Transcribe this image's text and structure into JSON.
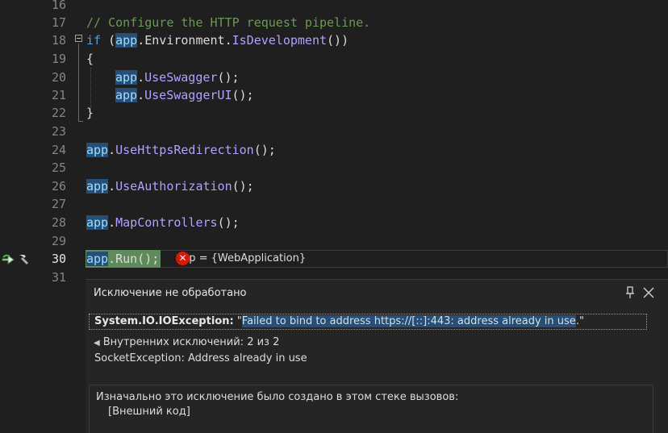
{
  "editor": {
    "line_numbers": [
      "16",
      "17",
      "18",
      "19",
      "20",
      "21",
      "22",
      "23",
      "24",
      "25",
      "26",
      "27",
      "28",
      "29",
      "30",
      "31"
    ],
    "current_line": "30",
    "lines": {
      "l17": "// Configure the HTTP request pipeline.",
      "l18_kw": "if",
      "l18_open": " (",
      "l18_var": "app",
      "l18_dot": ".",
      "l18_prop": "Environment",
      "l18_dot2": ".",
      "l18_method": "IsDevelopment",
      "l18_close": "())",
      "l19": "{",
      "l20_var": "app",
      "l20_dot": ".",
      "l20_method": "UseSwagger",
      "l20_end": "();",
      "l21_var": "app",
      "l21_dot": ".",
      "l21_method": "UseSwaggerUI",
      "l21_end": "();",
      "l22": "}",
      "l24_var": "app",
      "l24_dot": ".",
      "l24_method": "UseHttpsRedirection",
      "l24_end": "();",
      "l26_var": "app",
      "l26_dot": ".",
      "l26_method": "UseAuthorization",
      "l26_end": "();",
      "l28_var": "app",
      "l28_dot": ".",
      "l28_method": "MapControllers",
      "l28_end": "();",
      "l30_var": "app",
      "l30_dot": ".",
      "l30_method": "Run",
      "l30_end": "();"
    },
    "datatip": {
      "text": "app = {WebApplication}"
    }
  },
  "exception_popup": {
    "title": "Исключение не обработано",
    "exception_type": "System.IO.IOException:",
    "quote_open": " \"",
    "message": "Failed to bind to address https://[::]:443: address already in use",
    "quote_close": ".\"",
    "inner_nav": "Внутренних исключений: 2 из 2",
    "inner_exception": "SocketException: Address already in use",
    "stack_title": "Изначально это исключение было создано в этом стеке вызовов:",
    "stack_item": "[Внешний код]"
  },
  "colors": {
    "background": "#1f1f1f",
    "selection": "#264f78",
    "current_statement": "#5f8a5c",
    "error": "#e51400"
  },
  "icons": {
    "gutter": [
      "next-statement-arrow-icon",
      "hammer-icon"
    ],
    "datatip": "error-icon",
    "popup": [
      "pin-icon",
      "close-icon"
    ]
  }
}
